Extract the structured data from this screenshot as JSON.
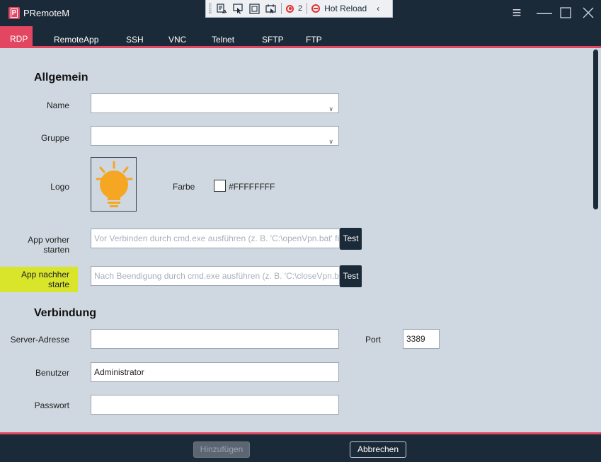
{
  "window": {
    "title": "PRemoteM",
    "logo_letter": "P"
  },
  "debug_toolbar": {
    "count": "2",
    "hot_reload_label": "Hot Reload"
  },
  "tabs": [
    {
      "label": "RDP",
      "active": true
    },
    {
      "label": "RemoteApp"
    },
    {
      "label": "SSH"
    },
    {
      "label": "VNC"
    },
    {
      "label": "Telnet"
    },
    {
      "label": "SFTP"
    },
    {
      "label": "FTP"
    }
  ],
  "form": {
    "general_title": "Allgemein",
    "name_label": "Name",
    "name_value": "",
    "group_label": "Gruppe",
    "group_value": "",
    "logo_label": "Logo",
    "color_label": "Farbe",
    "color_value": "#FFFFFFFF",
    "app_before_label": "App vorher starten",
    "app_before_placeholder": "Vor Verbinden durch cmd.exe ausführen (z. B. 'C:\\openVpn.bat' fü",
    "app_after_label": "App nachher starte",
    "app_after_placeholder": "Nach Beendigung durch cmd.exe ausführen (z. B. 'C:\\closeVpn.ba",
    "test_label": "Test",
    "connection_title": "Verbindung",
    "server_label": "Server-Adresse",
    "server_value": "",
    "port_label": "Port",
    "port_value": "3389",
    "user_label": "Benutzer",
    "user_value": "Administrator",
    "password_label": "Passwort",
    "password_value": ""
  },
  "footer": {
    "add_label": "Hinzufügen",
    "cancel_label": "Abbrechen"
  },
  "colors": {
    "accent": "#e24660",
    "dark": "#1b2a38",
    "background": "#cfd8e0",
    "highlight": "#d8e52a",
    "bulb": "#f5a623"
  }
}
